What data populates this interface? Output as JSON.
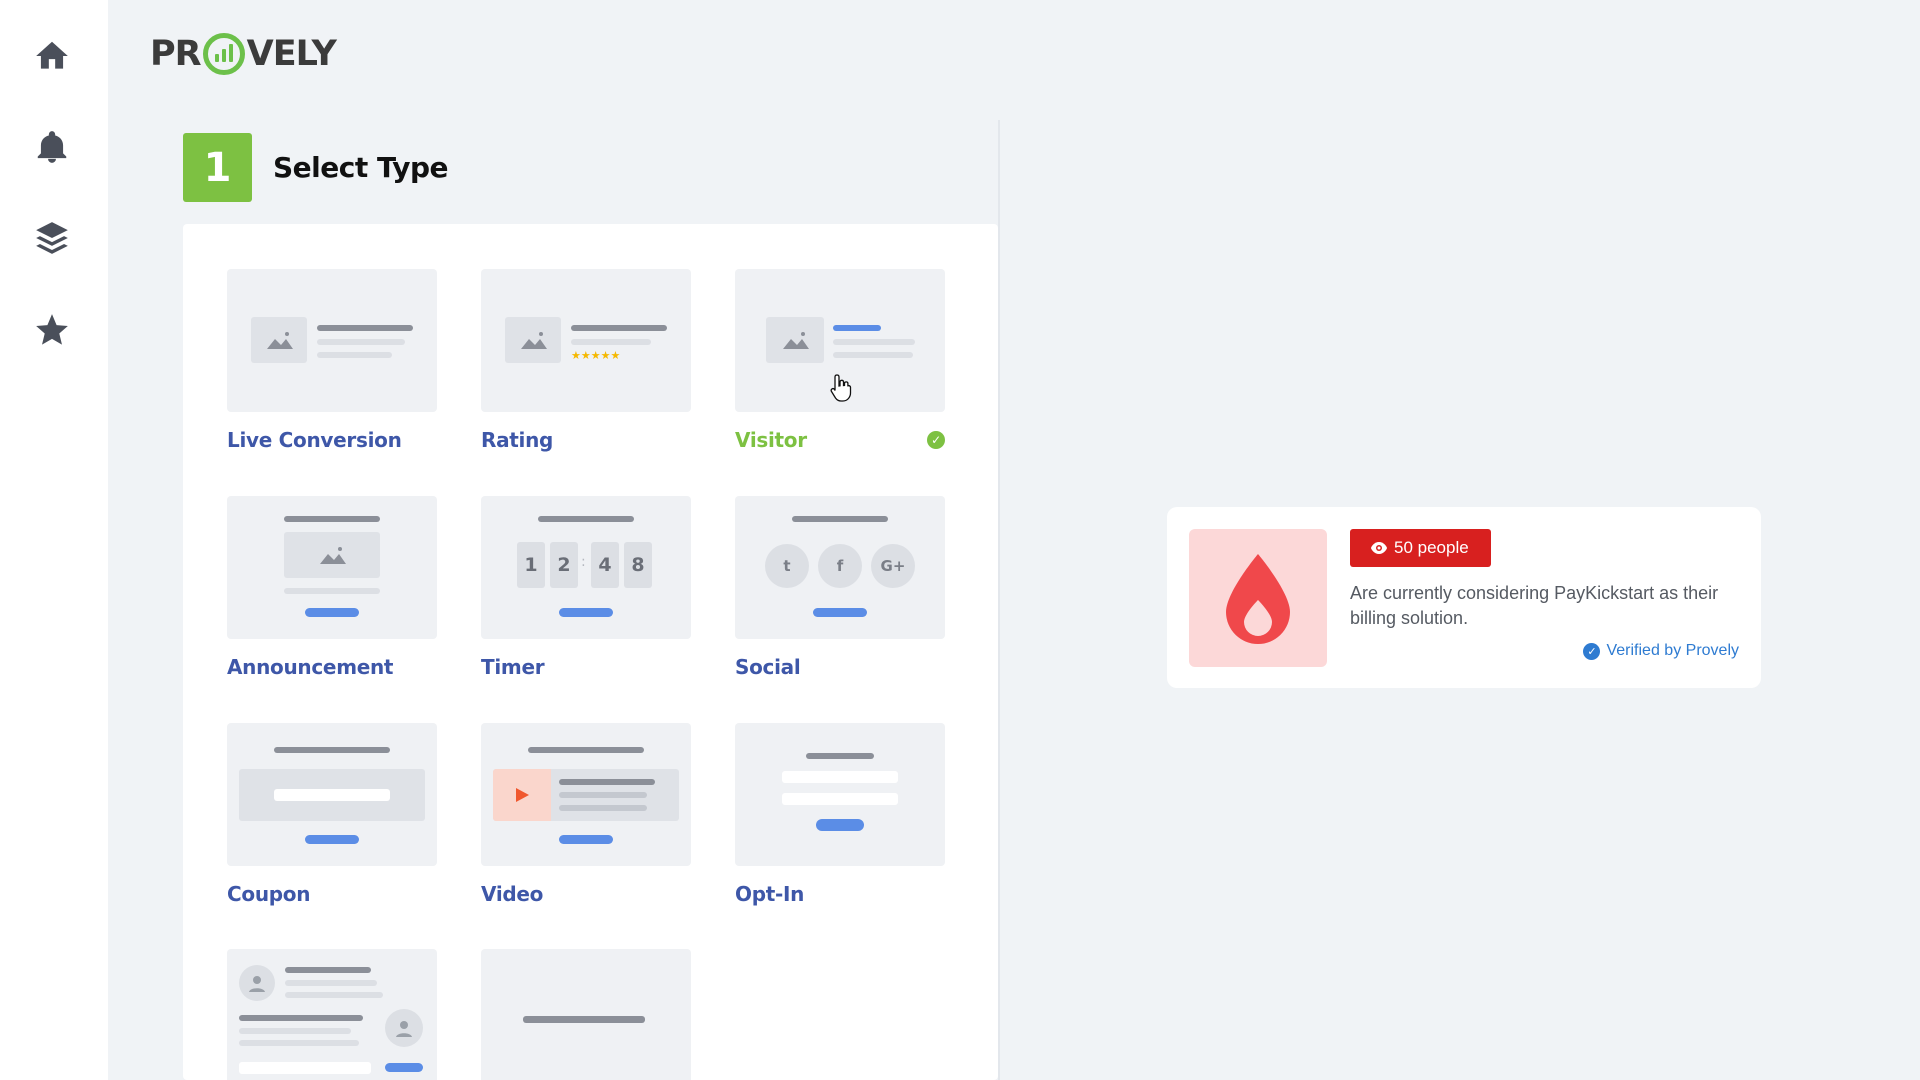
{
  "app": {
    "logo_text_left": "PR",
    "logo_text_right": "VELY"
  },
  "sidebar": {
    "items": [
      {
        "name": "home",
        "icon": "home-icon"
      },
      {
        "name": "notifications",
        "icon": "bell-icon"
      },
      {
        "name": "layers",
        "icon": "layers-icon"
      },
      {
        "name": "favorites",
        "icon": "star-icon"
      }
    ]
  },
  "step": {
    "number": "1",
    "title": "Select Type"
  },
  "types": [
    {
      "label": "Live Conversion",
      "selected": false
    },
    {
      "label": "Rating",
      "selected": false
    },
    {
      "label": "Visitor",
      "selected": true
    },
    {
      "label": "Announcement",
      "selected": false
    },
    {
      "label": "Timer",
      "selected": false
    },
    {
      "label": "Social",
      "selected": false
    },
    {
      "label": "Coupon",
      "selected": false
    },
    {
      "label": "Video",
      "selected": false
    },
    {
      "label": "Opt-In",
      "selected": false
    }
  ],
  "timer_digits": [
    "1",
    "2",
    "4",
    "8"
  ],
  "timer_separator": ":",
  "social_icons": [
    "t",
    "f",
    "G+"
  ],
  "preview": {
    "badge": "50 people",
    "message": "Are currently considering PayKickstart as their billing solution.",
    "verified": "Verified by Provely"
  },
  "colors": {
    "accent_green": "#7dc142",
    "label_blue": "#3e57a8",
    "badge_red": "#d8201f",
    "verified_blue": "#2e7bd1",
    "placeholder_blue": "#5b8de6"
  }
}
